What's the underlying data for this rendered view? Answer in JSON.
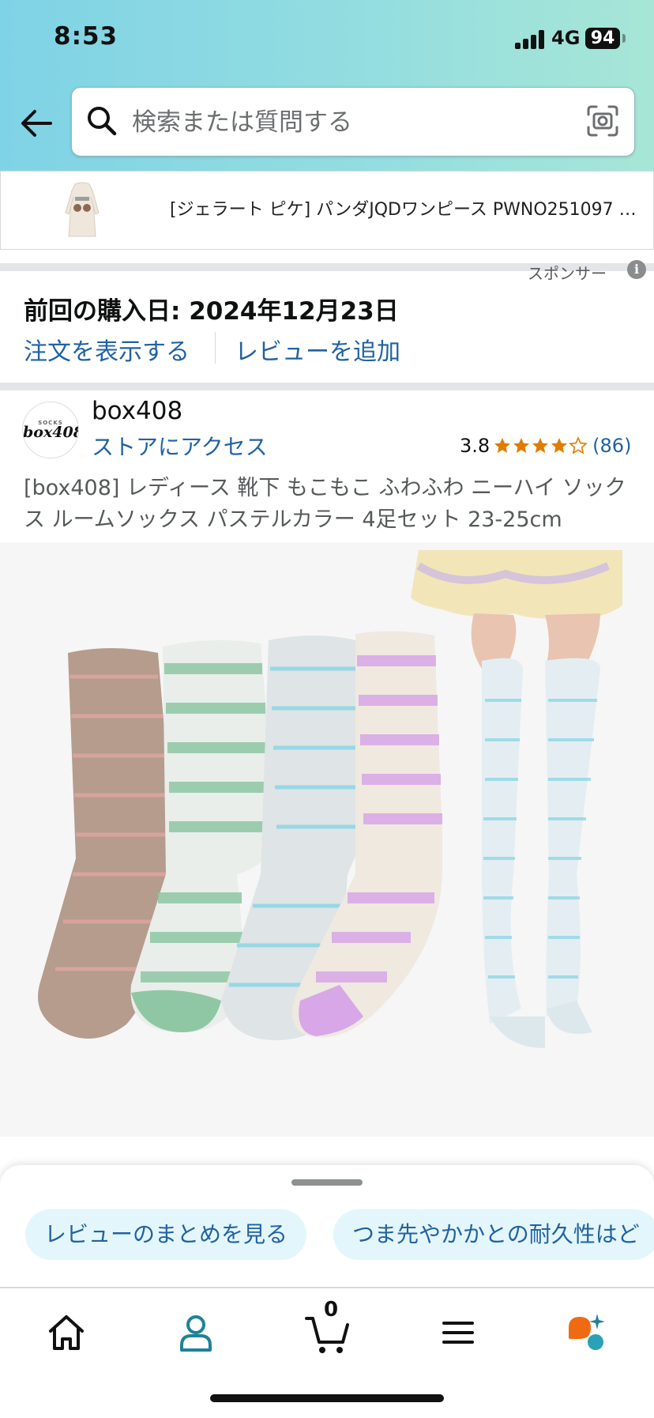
{
  "status_bar": {
    "time": "8:53",
    "network": "4G",
    "battery": "94"
  },
  "header": {
    "search_placeholder": "検索または質問する",
    "icons": [
      "back-arrow-icon",
      "search-icon",
      "camera-scan-icon"
    ],
    "gradient_colors": [
      "#7fd3e6",
      "#a7e6d6"
    ]
  },
  "sponsored_ad": {
    "text": "[ジェラート ピケ] パンダJQDワンピース PWNO251097 レ...",
    "label": "スポンサー"
  },
  "purchase_history": {
    "last_purchase": "前回の購入日: 2024年12月23日",
    "view_order": "注文を表示する",
    "add_review": "レビューを追加"
  },
  "brand": {
    "logo_small": "SOCKS",
    "logo_big": "box408",
    "name": "box408",
    "store_link": "ストアにアクセス"
  },
  "rating": {
    "value": "3.8",
    "count": "(86)",
    "stars_filled": 4,
    "stars_total": 5
  },
  "product": {
    "title": "[box408] レディース 靴下 もこもこ ふわふわ ニーハイ ソックス ルームソックス パステルカラー 4足セット 23-25cm"
  },
  "ai_sheet": {
    "chips": [
      "レビューのまとめを見る",
      "つま先やかかとの耐久性はど"
    ]
  },
  "bottom_nav": {
    "items": [
      "home-icon",
      "account-icon",
      "cart-icon",
      "menu-icon",
      "rufus-icon"
    ],
    "cart_count": "0",
    "accent": "#1f8297"
  }
}
